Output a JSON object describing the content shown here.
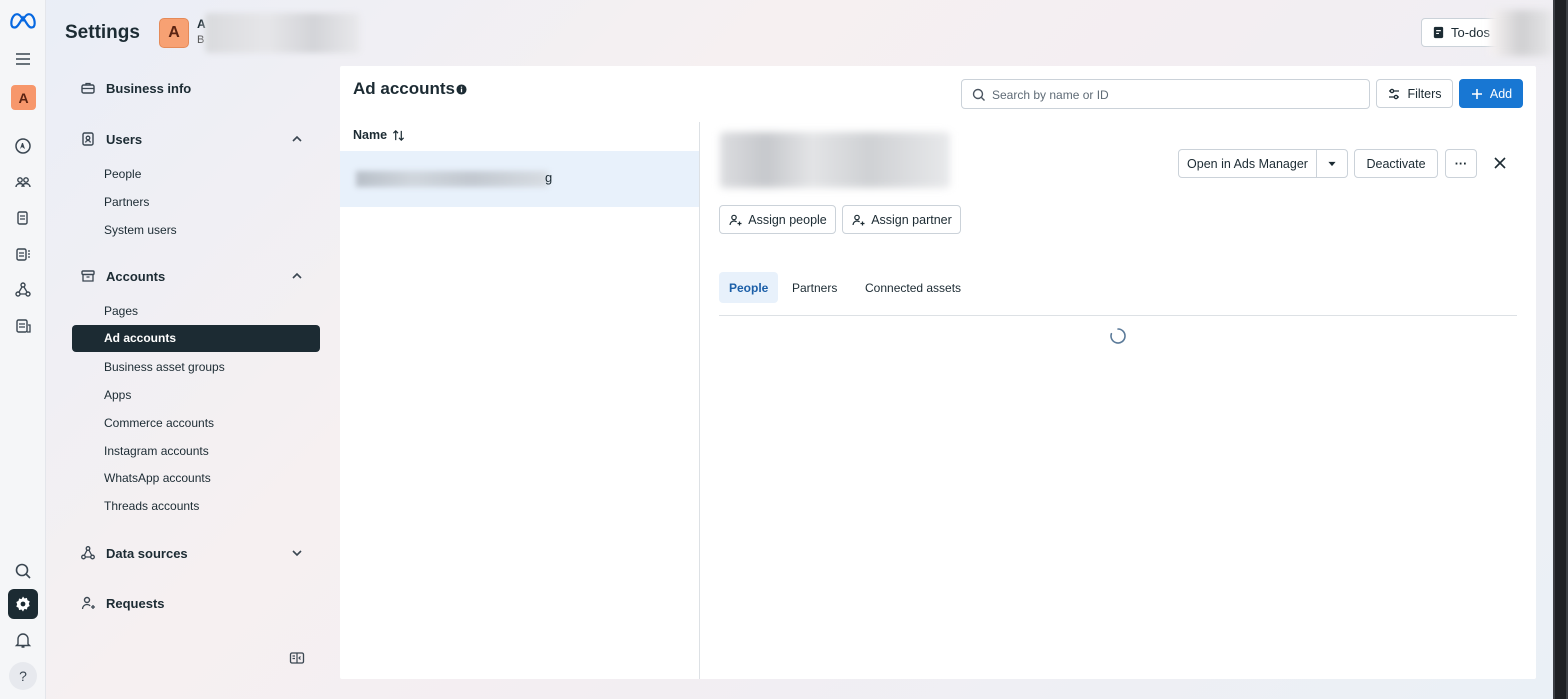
{
  "header": {
    "title": "Settings",
    "business_initial": "A",
    "business_name_visible": "A",
    "business_sub_visible": "B",
    "todos_label": "To-dos"
  },
  "rail": {
    "avatar_initial": "A",
    "help_label": "?"
  },
  "sidebar": {
    "business_info": "Business info",
    "users": {
      "label": "Users",
      "items": [
        "People",
        "Partners",
        "System users"
      ]
    },
    "accounts": {
      "label": "Accounts",
      "items": [
        "Pages",
        "Ad accounts",
        "Business asset groups",
        "Apps",
        "Commerce accounts",
        "Instagram accounts",
        "WhatsApp accounts",
        "Threads accounts"
      ],
      "active": "Ad accounts"
    },
    "data_sources": "Data sources",
    "requests": "Requests"
  },
  "main": {
    "title": "Ad accounts",
    "search_placeholder": "Search by name or ID",
    "filters_label": "Filters",
    "add_label": "Add",
    "column_name": "Name",
    "selected_row_tail": "g",
    "detail": {
      "open_ads_manager": "Open in Ads Manager",
      "deactivate": "Deactivate",
      "more": "···",
      "assign_people": "Assign people",
      "assign_partner": "Assign partner",
      "tabs": [
        "People",
        "Partners",
        "Connected assets"
      ],
      "active_tab": "People"
    }
  },
  "colors": {
    "primary": "#1877d3",
    "dark": "#1c2b33",
    "avatar": "#f7976b",
    "selected_bg": "#e8f1fb"
  }
}
